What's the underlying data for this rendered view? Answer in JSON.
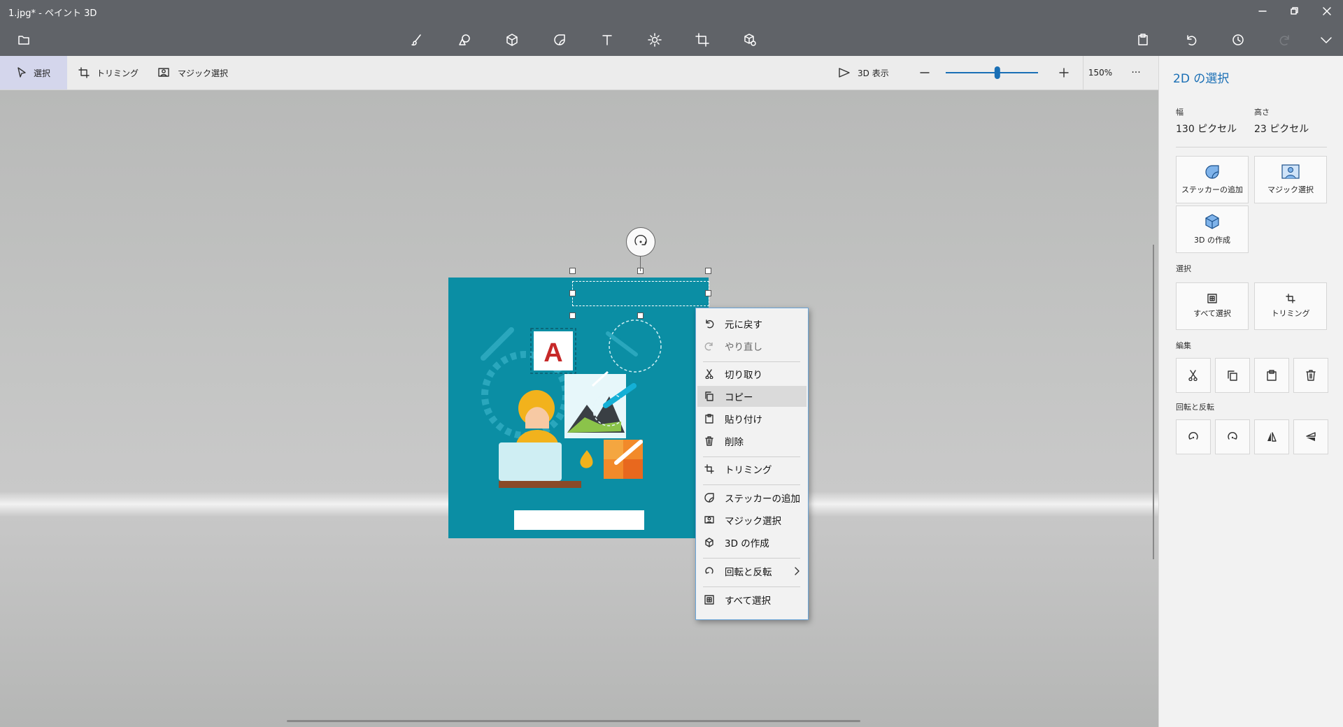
{
  "window": {
    "title": "1.jpg* - ペイント 3D"
  },
  "toolbar": {
    "tools": [
      "brushes",
      "2d-shapes",
      "3d-shapes",
      "stickers",
      "text",
      "effects",
      "canvas",
      "3d-library"
    ],
    "right_icons": [
      "paste",
      "undo",
      "history",
      "redo",
      "expand"
    ]
  },
  "subtoolbar": {
    "select_label": "選択",
    "trim_label": "トリミング",
    "magic_select_label": "マジック選択",
    "view3d_label": "3D 表示",
    "zoom_value": 0.52,
    "zoom_label": "150%",
    "more_label": "···"
  },
  "canvas": {
    "image_letter": "A"
  },
  "context_menu": {
    "items": [
      {
        "label": "元に戻す",
        "icon": "undo-icon"
      },
      {
        "label": "やり直し",
        "icon": "redo-icon",
        "disabled": true
      },
      {
        "label": "切り取り",
        "icon": "cut-icon"
      },
      {
        "label": "コピー",
        "icon": "copy-icon",
        "highlighted": true
      },
      {
        "label": "貼り付け",
        "icon": "paste-icon"
      },
      {
        "label": "削除",
        "icon": "delete-icon"
      },
      {
        "label": "トリミング",
        "icon": "crop-icon"
      },
      {
        "label": "ステッカーの追加",
        "icon": "sticker-icon"
      },
      {
        "label": "マジック選択",
        "icon": "magic-select-icon"
      },
      {
        "label": "3D の作成",
        "icon": "cube-icon"
      },
      {
        "label": "回転と反転",
        "icon": "rotate-icon",
        "submenu": true
      },
      {
        "label": "すべて選択",
        "icon": "select-all-icon"
      }
    ]
  },
  "panel": {
    "title": "2D の選択",
    "width_label": "幅",
    "width_value": "130 ピクセル",
    "height_label": "高さ",
    "height_value": "23 ピクセル",
    "add_sticker": "ステッカーの追加",
    "magic_select": "マジック選択",
    "make_3d": "3D の作成",
    "select_section": "選択",
    "select_all": "すべて選択",
    "trim": "トリミング",
    "edit_section": "編集",
    "rotate_section": "回転と反転"
  },
  "colors": {
    "accent": "#1a6fb5",
    "image_bg": "#0b8ea4",
    "titlebar": "#606368"
  }
}
